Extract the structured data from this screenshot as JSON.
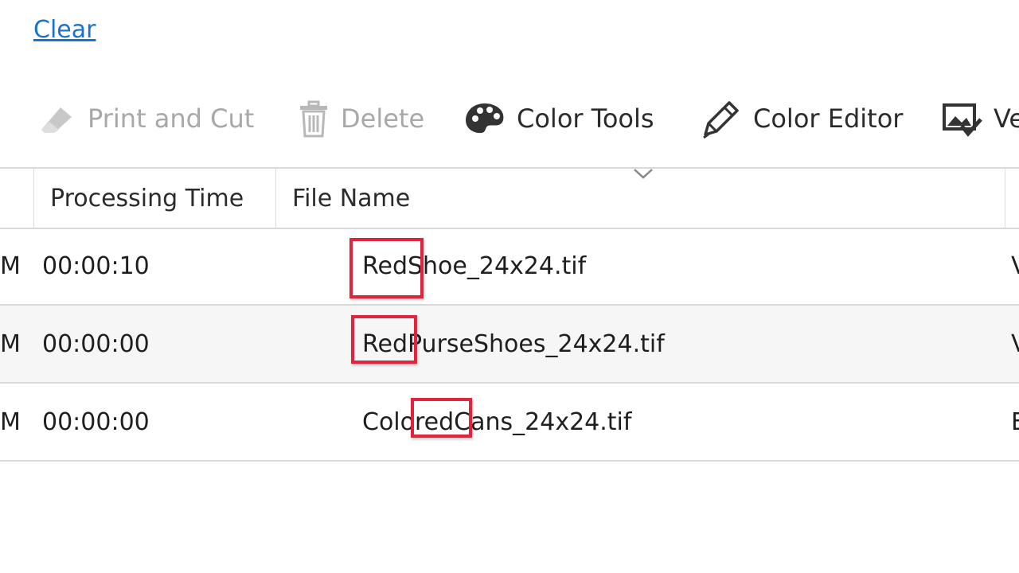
{
  "top": {
    "clear_link": "Clear"
  },
  "toolbar": {
    "print_cut": {
      "label": "Print and Cut",
      "icon": "eraser-icon"
    },
    "delete": {
      "label": "Delete",
      "icon": "trash-icon"
    },
    "color_tools": {
      "label": "Color Tools",
      "icon": "palette-icon"
    },
    "color_editor": {
      "label": "Color Editor",
      "icon": "pen-icon"
    },
    "partial": {
      "label": "Ve",
      "icon": "image-check-icon"
    }
  },
  "grid": {
    "headers": {
      "processing_time": "Processing Time",
      "file_name": "File Name"
    },
    "rows": [
      {
        "date_tail": "M",
        "time": "00:00:10",
        "file": "RedShoe_24x24.tif",
        "extra": "V"
      },
      {
        "date_tail": "M",
        "time": "00:00:00",
        "file": "RedPurseShoes_24x24.tif",
        "extra": "V"
      },
      {
        "date_tail": "M",
        "time": "00:00:00",
        "file": "ColoredCans_24x24.tif",
        "extra": "E"
      }
    ]
  },
  "colors": {
    "highlight": "#e0243f",
    "link": "#1a73c8",
    "disabled_text": "#a8a8a8"
  }
}
